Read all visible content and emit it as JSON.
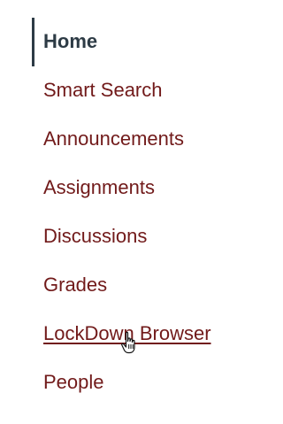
{
  "course_nav": {
    "items": [
      {
        "label": "Home",
        "active": true
      },
      {
        "label": "Smart Search"
      },
      {
        "label": "Announcements"
      },
      {
        "label": "Assignments"
      },
      {
        "label": "Discussions"
      },
      {
        "label": "Grades"
      },
      {
        "label": "LockDown Browser",
        "hovered": true
      },
      {
        "label": "People"
      }
    ]
  },
  "cursor": {
    "icon": "hand-pointer-icon"
  },
  "colors": {
    "link": "#711a1a",
    "active_text": "#2d3b45",
    "active_indicator": "#2d3b45",
    "background": "#ffffff"
  }
}
